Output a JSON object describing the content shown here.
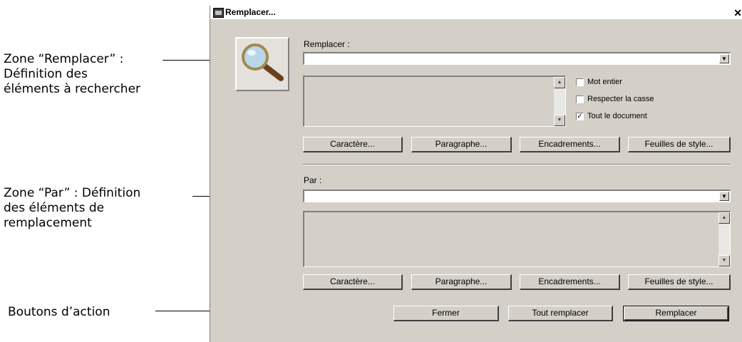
{
  "annotations": {
    "zone_remplacer": [
      "Zone “Remplacer” :",
      "Définition des",
      "éléments à rechercher"
    ],
    "zone_par": [
      "Zone “Par” : Définition",
      "des éléments de",
      "remplacement"
    ],
    "boutons": "Boutons d’action"
  },
  "window": {
    "title": "Remplacer...",
    "close": "✕"
  },
  "find": {
    "label": "Remplacer :",
    "value": "",
    "options": [
      {
        "label": "Mot entier",
        "checked": false
      },
      {
        "label": "Respecter la casse",
        "checked": false
      },
      {
        "label": "Tout le document",
        "checked": true
      }
    ],
    "buttons": [
      "Caractère...",
      "Paragraphe...",
      "Encadrements...",
      "Feuilles de style..."
    ]
  },
  "replace": {
    "label": "Par :",
    "value": "",
    "buttons": [
      "Caractère...",
      "Paragraphe...",
      "Encadrements...",
      "Feuilles de style..."
    ]
  },
  "actions": {
    "close": "Fermer",
    "replace_all": "Tout remplacer",
    "replace": "Remplacer"
  }
}
